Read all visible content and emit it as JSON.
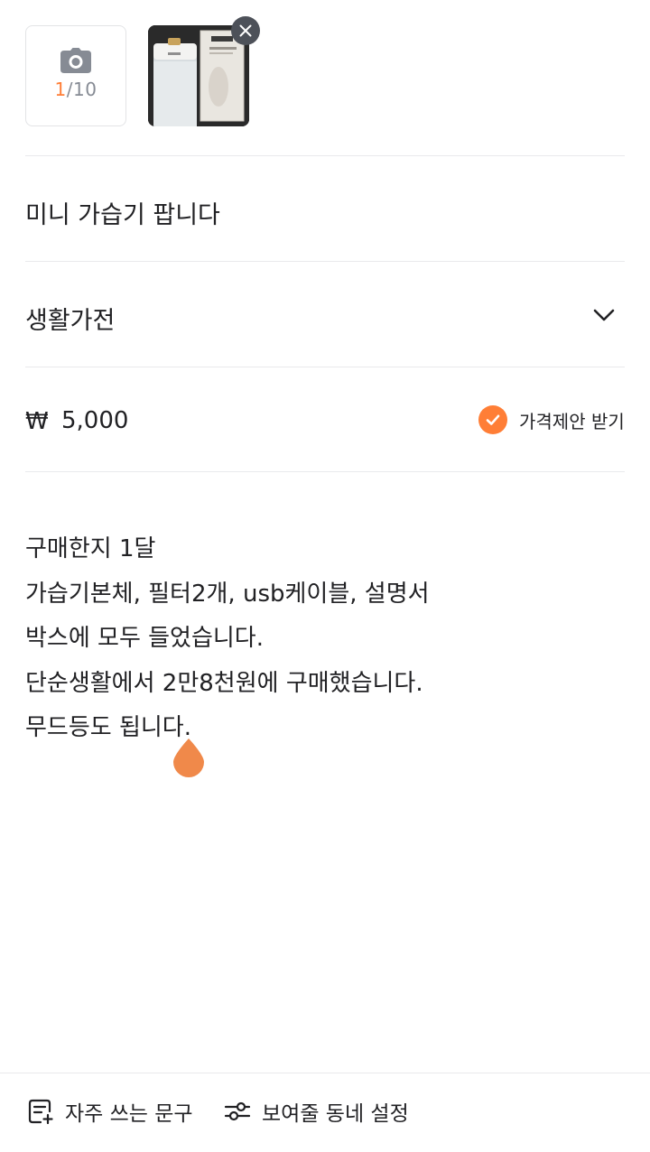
{
  "photos": {
    "count_current": "1",
    "count_total": "/10",
    "thumbnail_icon": "photo-thumbnail",
    "remove_icon": "close-icon"
  },
  "title": {
    "value": "미니 가습기 팝니다"
  },
  "category": {
    "value": "생활가전",
    "icon": "chevron-down-icon"
  },
  "price": {
    "currency": "₩",
    "value": "5,000",
    "offer_label": "가격제안 받기",
    "offer_checked": true
  },
  "description": {
    "lines": [
      "구매한지 1달",
      "가습기본체, 필터2개, usb케이블, 설명서",
      "박스에 모두 들었습니다.",
      "단순생활에서 2만8천원에 구매했습니다.",
      "무드등도 됩니다."
    ]
  },
  "bottom_bar": {
    "phrases_label": "자주 쓰는 문구",
    "neighborhood_label": "보여줄 동네 설정"
  },
  "colors": {
    "accent": "#ff7e36",
    "text": "#212124",
    "muted": "#868b94",
    "divider": "#e9eaec"
  }
}
